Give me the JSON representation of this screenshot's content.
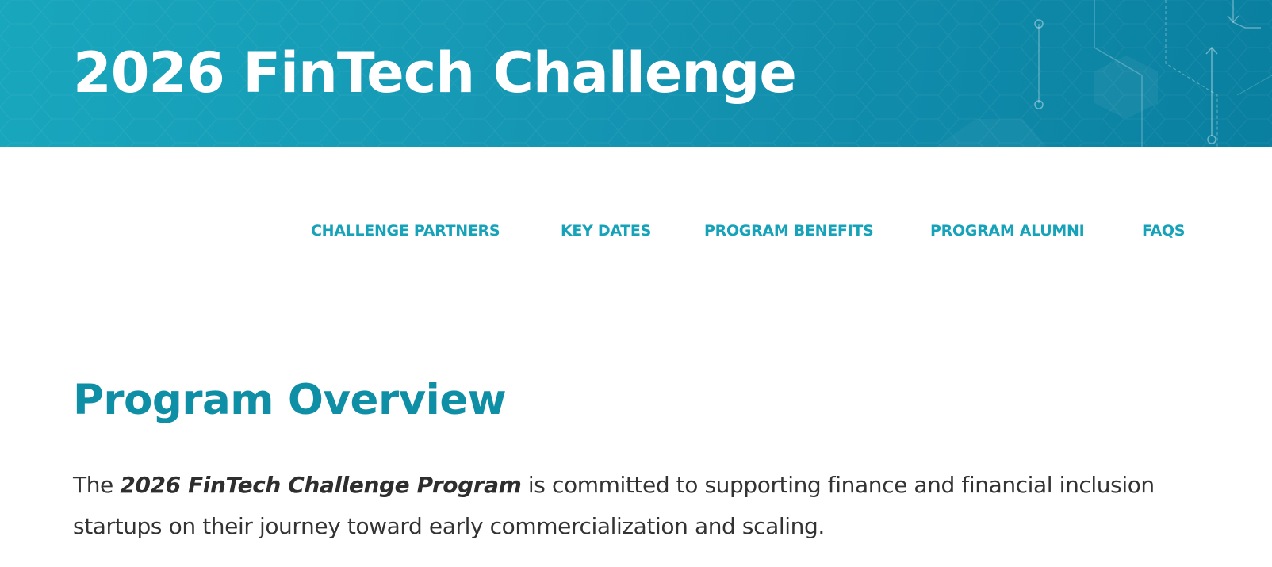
{
  "hero": {
    "title": "2026 FinTech Challenge"
  },
  "nav": {
    "items": [
      {
        "label": "CHALLENGE PARTNERS"
      },
      {
        "label": "KEY DATES"
      },
      {
        "label": "PROGRAM BENEFITS"
      },
      {
        "label": "PROGRAM ALUMNI"
      },
      {
        "label": "FAQS"
      }
    ]
  },
  "overview": {
    "title": "Program Overview",
    "intro_prefix": "The ",
    "intro_bold": "2026 FinTech Challenge Program",
    "intro_rest": " is committed to supporting finance and financial inclusion startups on their journey toward early commercialization and scaling."
  },
  "colors": {
    "hero_start": "#18a7bd",
    "hero_end": "#0a7fa0",
    "nav_link": "#16a2b8",
    "heading": "#0f8fa6",
    "body_text": "#333333"
  }
}
